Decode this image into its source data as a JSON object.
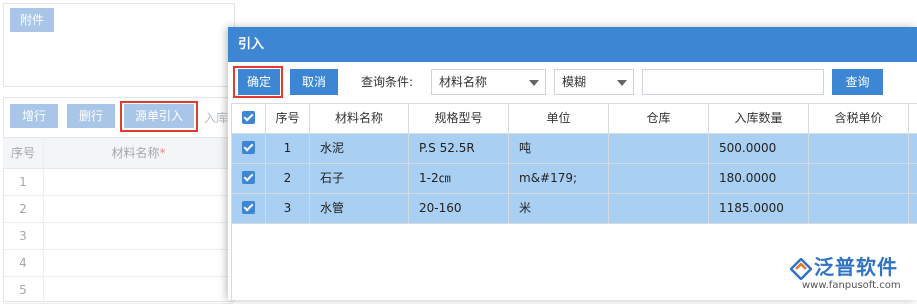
{
  "background": {
    "attachment_button": "附件",
    "toolbar": {
      "add_row": "增行",
      "delete_row": "删行",
      "source_import": "源单引入",
      "partial_label": "入库"
    },
    "table": {
      "headers": {
        "no": "序号",
        "name": "材料名称"
      },
      "required_mark": "*",
      "rows": [
        "1",
        "2",
        "3",
        "4",
        "5"
      ]
    }
  },
  "dialog": {
    "title": "引入",
    "toolbar": {
      "confirm": "确定",
      "cancel": "取消",
      "query_label": "查询条件:",
      "field_select": "材料名称",
      "mode_select": "模糊",
      "search_value": "",
      "query_button": "查询"
    },
    "grid": {
      "headers": {
        "no": "序号",
        "name": "材料名称",
        "spec": "规格型号",
        "unit": "单位",
        "warehouse": "仓库",
        "qty": "入库数量",
        "price": "含税单价"
      },
      "rows": [
        {
          "checked": true,
          "no": "1",
          "name": "水泥",
          "spec": "P.S 52.5R",
          "unit": "吨",
          "warehouse": "",
          "qty": "500.0000",
          "price": ""
        },
        {
          "checked": true,
          "no": "2",
          "name": "石子",
          "spec": "1-2㎝",
          "unit": "m&#179;",
          "warehouse": "",
          "qty": "180.0000",
          "price": ""
        },
        {
          "checked": true,
          "no": "3",
          "name": "水管",
          "spec": "20-160",
          "unit": "米",
          "warehouse": "",
          "qty": "1185.0000",
          "price": ""
        }
      ]
    }
  },
  "watermark": {
    "brand": "泛普软件",
    "url": "www.fanpusoft.com"
  },
  "colors": {
    "accent": "#3d86d4",
    "selected_row": "#a9cff2",
    "disabled_button": "#a9c6e8",
    "highlight_outline": "#e23b2e"
  }
}
